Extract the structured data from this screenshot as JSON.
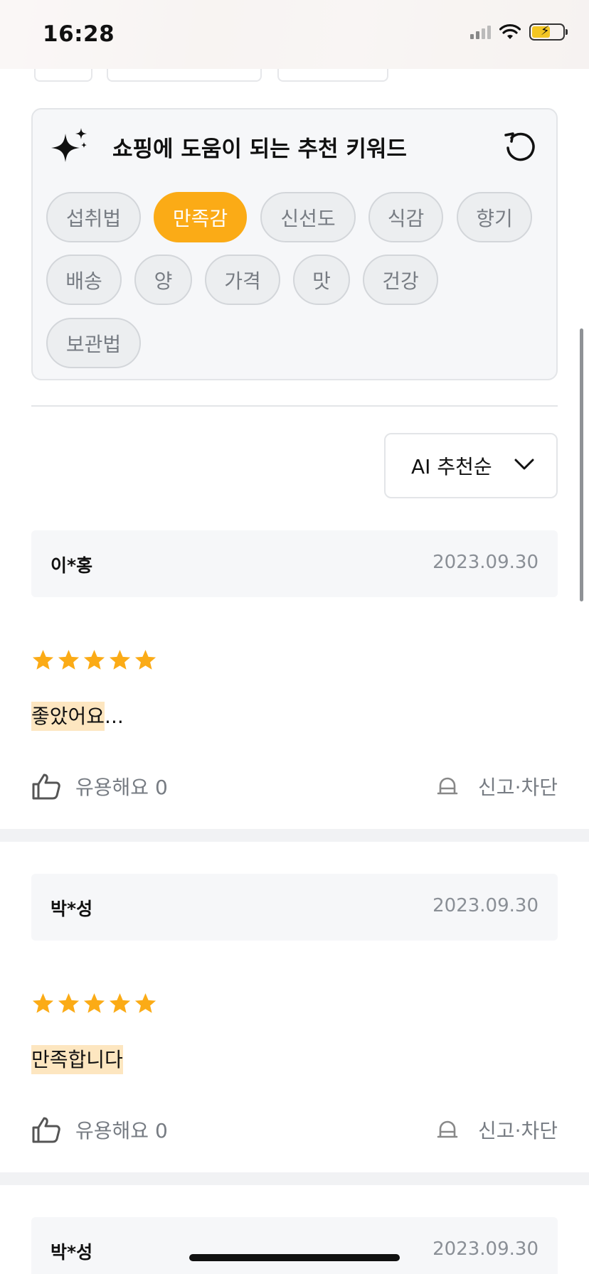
{
  "status": {
    "time": "16:28"
  },
  "keywords": {
    "title": "쇼핑에 도움이 되는 추천 키워드",
    "chips": [
      "섭취법",
      "만족감",
      "신선도",
      "식감",
      "향기",
      "배송",
      "양",
      "가격",
      "맛",
      "건강",
      "보관법"
    ],
    "active": "만족감"
  },
  "sort": {
    "label": "AI 추천순"
  },
  "reviews": [
    {
      "name": "이*홍",
      "date": "2023.09.30",
      "rating": 5,
      "text": "좋았어요",
      "text_suffix": "...",
      "helpful": "유용해요 0",
      "report": "신고·차단"
    },
    {
      "name": "박*성",
      "date": "2023.09.30",
      "rating": 5,
      "text": "만족합니다",
      "text_suffix": "",
      "helpful": "유용해요 0",
      "report": "신고·차단"
    },
    {
      "name": "박*성",
      "date": "2023.09.30"
    }
  ],
  "colors": {
    "accent": "#fbab16",
    "highlight": "#fde6c0",
    "muted": "#777c83"
  }
}
